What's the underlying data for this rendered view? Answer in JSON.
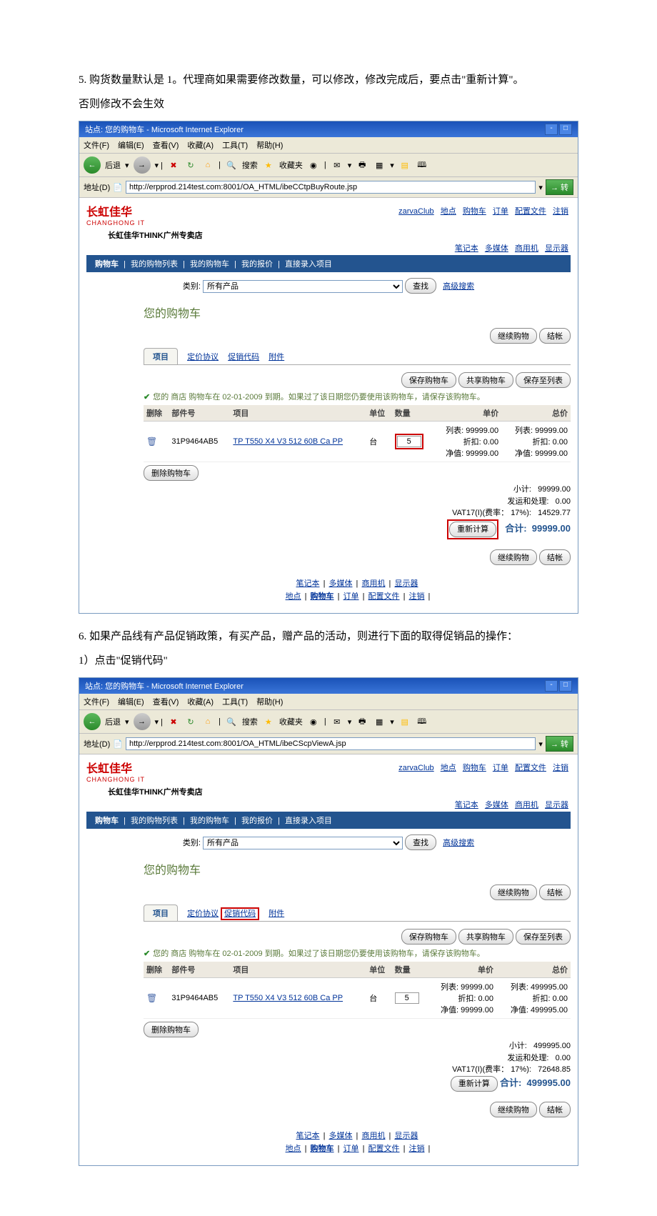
{
  "step5_text1": "5. 购货数量默认是 1。代理商如果需要修改数量，可以修改，修改完成后，要点击\"重新计算\"。",
  "step5_text2": "否则修改不会生效",
  "step6_text1": "6. 如果产品线有产品促销政策，有买产品，赠产品的活动，则进行下面的取得促销品的操作：",
  "step6_text2": "1）点击\"促销代码\"",
  "ie": {
    "title": "站点:    您的购物车 - Microsoft Internet Explorer",
    "menu": {
      "file": "文件(F)",
      "edit": "编辑(E)",
      "view": "查看(V)",
      "fav": "收藏(A)",
      "tools": "工具(T)",
      "help": "帮助(H)"
    },
    "back": "后退",
    "search": "搜索",
    "favorites": "收藏夹",
    "addrlabel": "地址(D)",
    "go": "转"
  },
  "win1": {
    "url": "http://erpprod.214test.com:8001/OA_HTML/ibeCCtpBuyRoute.jsp",
    "brand_cn": "长虹佳华",
    "brand_en": "CHANGHONG IT",
    "store": "长虹佳华THINK广州专卖店",
    "toplinks": {
      "club": "zarvaClub",
      "site": "地点",
      "cart": "购物车",
      "order": "订单",
      "config": "配置文件",
      "logout": "注销"
    },
    "subnav": {
      "nb": "笔记本",
      "mm": "多媒体",
      "biz": "商用机",
      "mon": "显示器"
    },
    "nav": {
      "cart": "购物车",
      "list": "我的购物列表",
      "mycart": "我的购物车",
      "quote": "我的报价",
      "direct": "直接录入项目"
    },
    "search": {
      "label": "类别:",
      "all": "所有产品",
      "find": "查找",
      "adv": "高级搜索"
    },
    "cart_title": "您的购物车",
    "btns": {
      "continue": "继续购物",
      "checkout": "结帐",
      "save": "保存购物车",
      "share": "共享购物车",
      "savelist": "保存至列表",
      "clear": "删除购物车",
      "recalc": "重新计算"
    },
    "tabs": {
      "item": "项目",
      "price": "定价协议",
      "promo": "促销代码",
      "attach": "附件"
    },
    "notice": "您的 商店 购物车在 02-01-2009 到期。如果过了该日期您仍要使用该购物车，请保存该购物车。",
    "cols": {
      "del": "删除",
      "part": "部件号",
      "item": "项目",
      "unit": "单位",
      "qty": "数量",
      "price": "单价",
      "total": "总价"
    },
    "row": {
      "part": "31P9464AB5",
      "name": "TP T550 X4 V3 512 60B Ca PP",
      "unit": "台",
      "qty": "5",
      "list_lbl": "列表:",
      "disc_lbl": "折扣:",
      "net_lbl": "净值:",
      "list": "99999.00",
      "disc": "0.00",
      "net": "99999.00",
      "tlist": "99999.00",
      "tdisc": "0.00",
      "tnet": "99999.00"
    },
    "totals": {
      "sub_lbl": "小计:",
      "sub": "99999.00",
      "ship_lbl": "发运和处理:",
      "ship": "0.00",
      "tax_lbl": "VAT17(I)(费率： 17%):",
      "tax": "14529.77",
      "grand_lbl": "合计:",
      "grand": "99999.00"
    },
    "footer": {
      "nb": "笔记本",
      "mm": "多媒体",
      "biz": "商用机",
      "mon": "显示器",
      "site": "地点",
      "cart": "购物车",
      "order": "订单",
      "config": "配置文件",
      "logout": "注销"
    }
  },
  "win2": {
    "url": "http://erpprod.214test.com:8001/OA_HTML/ibeCScpViewA.jsp",
    "row": {
      "qty": "5",
      "tlist": "499995.00",
      "tdisc": "0.00",
      "tnet": "499995.00"
    },
    "totals": {
      "sub": "499995.00",
      "ship": "0.00",
      "tax": "72648.85",
      "grand": "499995.00"
    }
  }
}
